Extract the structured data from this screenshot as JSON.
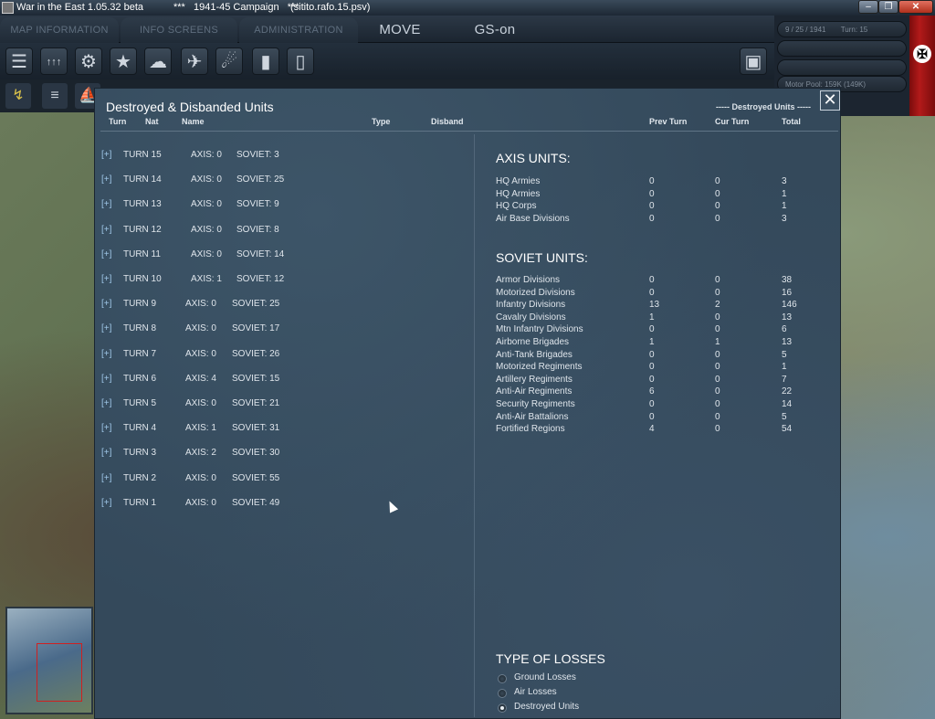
{
  "window": {
    "app_title": "War in the East 1.05.32 beta",
    "campaign": "***   1941-45 Campaign   ***",
    "file": "(sitito.rafo.15.psv)",
    "controls": [
      "–",
      "❐",
      "✕"
    ]
  },
  "menu": {
    "tabs": [
      "MAP INFORMATION",
      "INFO SCREENS",
      "ADMINISTRATION"
    ],
    "phase": "MOVE",
    "gs": "GS-on"
  },
  "toolbar": {
    "icons": [
      "layers-icon",
      "units-icon",
      "gear-icon",
      "star-icon",
      "weather-icon",
      "air-icon",
      "rocket-icon",
      "supply-icon",
      "report-icon"
    ],
    "glyphs": [
      "☰",
      "↑↑↑",
      "⚙",
      "★",
      "☁",
      "✈",
      "☄",
      "▮",
      "▯"
    ],
    "right_icon_glyph": "▣"
  },
  "status": {
    "date": "9 / 25 / 1941",
    "turn": "Turn: 15",
    "motor_pool": "Motor Pool: 159K (149K)",
    "flag_symbol": "✠"
  },
  "dialog": {
    "title": "Destroyed & Disbanded Units",
    "mode": "----- Destroyed Units -----",
    "close": "✕",
    "columns": {
      "turn": "Turn",
      "nat": "Nat",
      "name": "Name",
      "type": "Type",
      "disband": "Disband",
      "prev_turn": "Prev Turn",
      "cur_turn": "Cur Turn",
      "total": "Total"
    },
    "turns": [
      {
        "expand": "[+]",
        "turn": "TURN 15",
        "axis": "AXIS: 0",
        "soviet": "SOVIET: 3"
      },
      {
        "expand": "[+]",
        "turn": "TURN 14",
        "axis": "AXIS: 0",
        "soviet": "SOVIET: 25"
      },
      {
        "expand": "[+]",
        "turn": "TURN 13",
        "axis": "AXIS: 0",
        "soviet": "SOVIET: 9"
      },
      {
        "expand": "[+]",
        "turn": "TURN 12",
        "axis": "AXIS: 0",
        "soviet": "SOVIET: 8"
      },
      {
        "expand": "[+]",
        "turn": "TURN 11",
        "axis": "AXIS: 0",
        "soviet": "SOVIET: 14"
      },
      {
        "expand": "[+]",
        "turn": "TURN 10",
        "axis": "AXIS: 1",
        "soviet": "SOVIET: 12"
      },
      {
        "expand": "[+]",
        "turn": "TURN 9",
        "axis": "AXIS: 0",
        "soviet": "SOVIET: 25"
      },
      {
        "expand": "[+]",
        "turn": "TURN 8",
        "axis": "AXIS: 0",
        "soviet": "SOVIET: 17"
      },
      {
        "expand": "[+]",
        "turn": "TURN 7",
        "axis": "AXIS: 0",
        "soviet": "SOVIET: 26"
      },
      {
        "expand": "[+]",
        "turn": "TURN 6",
        "axis": "AXIS: 4",
        "soviet": "SOVIET: 15"
      },
      {
        "expand": "[+]",
        "turn": "TURN 5",
        "axis": "AXIS: 0",
        "soviet": "SOVIET: 21"
      },
      {
        "expand": "[+]",
        "turn": "TURN 4",
        "axis": "AXIS: 1",
        "soviet": "SOVIET: 31"
      },
      {
        "expand": "[+]",
        "turn": "TURN 3",
        "axis": "AXIS: 2",
        "soviet": "SOVIET: 30"
      },
      {
        "expand": "[+]",
        "turn": "TURN 2",
        "axis": "AXIS: 0",
        "soviet": "SOVIET: 55"
      },
      {
        "expand": "[+]",
        "turn": "TURN 1",
        "axis": "AXIS: 0",
        "soviet": "SOVIET: 49"
      }
    ],
    "axis_title": "AXIS UNITS:",
    "axis_units": [
      {
        "name": "HQ Armies",
        "prev": "0",
        "cur": "0",
        "total": "3"
      },
      {
        "name": "HQ Armies",
        "prev": "0",
        "cur": "0",
        "total": "1"
      },
      {
        "name": "HQ Corps",
        "prev": "0",
        "cur": "0",
        "total": "1"
      },
      {
        "name": "Air Base Divisions",
        "prev": "0",
        "cur": "0",
        "total": "3"
      }
    ],
    "soviet_title": "SOVIET UNITS:",
    "soviet_units": [
      {
        "name": "Armor Divisions",
        "prev": "0",
        "cur": "0",
        "total": "38"
      },
      {
        "name": "Motorized Divisions",
        "prev": "0",
        "cur": "0",
        "total": "16"
      },
      {
        "name": "Infantry Divisions",
        "prev": "13",
        "cur": "2",
        "total": "146"
      },
      {
        "name": "Cavalry Divisions",
        "prev": "1",
        "cur": "0",
        "total": "13"
      },
      {
        "name": "Mtn Infantry Divisions",
        "prev": "0",
        "cur": "0",
        "total": "6"
      },
      {
        "name": "Airborne Brigades",
        "prev": "1",
        "cur": "1",
        "total": "13"
      },
      {
        "name": "Anti-Tank Brigades",
        "prev": "0",
        "cur": "0",
        "total": "5"
      },
      {
        "name": "Motorized Regiments",
        "prev": "0",
        "cur": "0",
        "total": "1"
      },
      {
        "name": "Artillery Regiments",
        "prev": "0",
        "cur": "0",
        "total": "7"
      },
      {
        "name": "Anti-Air Regiments",
        "prev": "6",
        "cur": "0",
        "total": "22"
      },
      {
        "name": "Security Regiments",
        "prev": "0",
        "cur": "0",
        "total": "14"
      },
      {
        "name": "Anti-Air Battalions",
        "prev": "0",
        "cur": "0",
        "total": "5"
      },
      {
        "name": "Fortified Regions",
        "prev": "4",
        "cur": "0",
        "total": "54"
      }
    ],
    "losses_title": "TYPE OF LOSSES",
    "loss_options": [
      {
        "label": "Ground Losses",
        "selected": false
      },
      {
        "label": "Air Losses",
        "selected": false
      },
      {
        "label": "Destroyed Units",
        "selected": true
      }
    ]
  }
}
